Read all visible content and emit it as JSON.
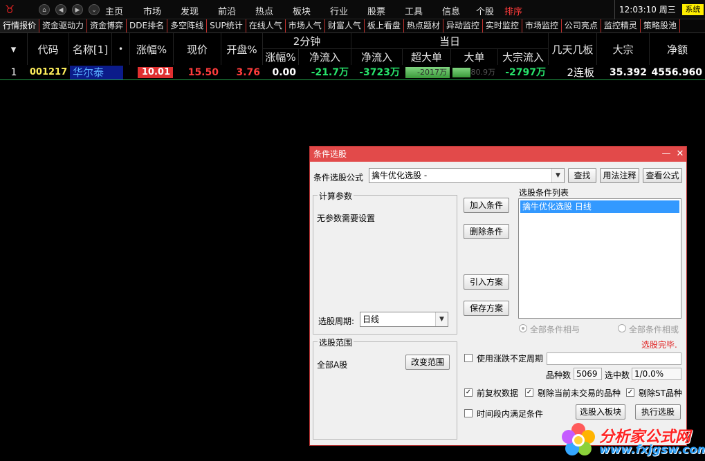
{
  "menubar": {
    "items": [
      "主页",
      "市场",
      "发现",
      "前沿",
      "热点",
      "板块",
      "行业",
      "股票",
      "工具",
      "信息",
      "个股",
      "排序"
    ],
    "clock": "12:03:10 周三",
    "sys_label": "系统"
  },
  "tabs": [
    "行情报价",
    "资金驱动力",
    "资金博弈",
    "DDE排名",
    "多空阵线",
    "SUP统计",
    "在线人气",
    "市场人气",
    "财富人气",
    "板上看盘",
    "热点题材",
    "异动监控",
    "实时监控",
    "市场监控",
    "公司亮点",
    "监控精灵",
    "策略股池"
  ],
  "table": {
    "headers": {
      "code": "代码",
      "name": "名称[1]",
      "dot": "•",
      "change_pct": "涨幅%",
      "price": "现价",
      "open_pct": "开盘%",
      "two_min": "2分钟",
      "tm_change": "涨幅%",
      "tm_netflow": "净流入",
      "today": "当日",
      "td_netflow": "净流入",
      "td_superlarge": "超大单",
      "td_large": "大单",
      "td_bigflow": "大宗流入",
      "board_days": "几天几板",
      "bulk": "大宗",
      "net_amount": "净额"
    },
    "rows": [
      {
        "index": "1",
        "code": "001217",
        "name": "华尔泰",
        "change_pct": "10.01",
        "price": "15.50",
        "open_pct": "3.76",
        "tm_change": "0.00",
        "tm_netflow": "-21.7万",
        "td_netflow": "-3723万",
        "td_superlarge": "-2017万",
        "td_large": "-780.9万",
        "td_bigflow": "-2797万",
        "board_days": "2连板",
        "bulk": "35.392",
        "net_amount": "4556.960"
      }
    ]
  },
  "dialog": {
    "title": "条件选股",
    "formula_label": "条件选股公式",
    "formula_value": "擒牛优化选股 -",
    "btn_find": "查找",
    "btn_usage": "用法注释",
    "btn_view": "查看公式",
    "params_group": "计算参数",
    "params_text": "无参数需要设置",
    "period_label": "选股周期:",
    "period_value": "日线",
    "btn_add": "加入条件",
    "btn_delete": "删除条件",
    "btn_import": "引入方案",
    "btn_save": "保存方案",
    "cond_list_label": "选股条件列表",
    "cond_items": [
      "擒牛优化选股  日线"
    ],
    "radio_and": "全部条件相与",
    "radio_or": "全部条件相或",
    "status": "选股完毕.",
    "range_group": "选股范围",
    "range_value": "全部A股",
    "btn_change_range": "改变范围",
    "chk_uncertain": "使用涨跌不定周期",
    "count_label": "品种数",
    "count_value": "5069",
    "selected_label": "选中数",
    "selected_value": "1/0.0%",
    "chk_fq": "前复权数据",
    "chk_no_trade": "剔除当前未交易的品种",
    "chk_st": "剔除ST品种",
    "chk_period": "时间段内满足条件",
    "btn_to_block": "选股入板块",
    "btn_execute": "执行选股"
  },
  "watermark": {
    "title": "分析家公式网",
    "url": "www.fxjgsw.com"
  }
}
